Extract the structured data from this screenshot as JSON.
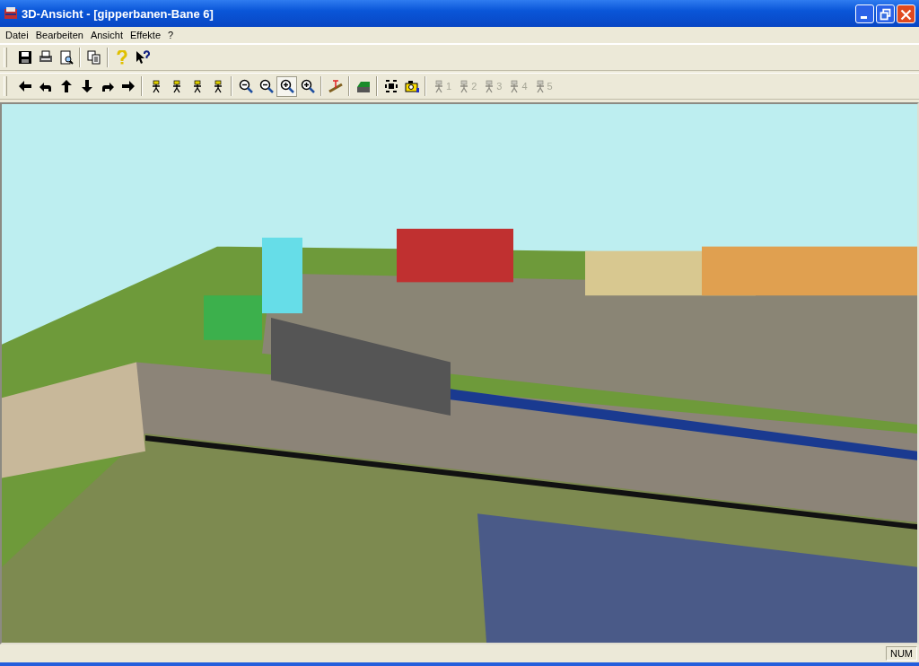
{
  "window": {
    "title": "3D-Ansicht - [gipperbanen-Bane 6]"
  },
  "menu": [
    {
      "label": "Datei"
    },
    {
      "label": "Bearbeiten"
    },
    {
      "label": "Ansicht"
    },
    {
      "label": "Effekte"
    },
    {
      "label": "?"
    }
  ],
  "toolbar_1": [
    [
      {
        "kind": "save",
        "selected": false
      },
      {
        "kind": "print",
        "selected": false
      },
      {
        "kind": "preview",
        "selected": false
      }
    ],
    [
      {
        "kind": "copy",
        "selected": false
      }
    ],
    [
      {
        "kind": "help",
        "selected": false
      },
      {
        "kind": "context-help",
        "selected": false
      }
    ]
  ],
  "toolbar_2": [
    [
      {
        "kind": "left",
        "selected": false
      },
      {
        "kind": "turn-left",
        "selected": false
      },
      {
        "kind": "up",
        "selected": false
      },
      {
        "kind": "down",
        "selected": false
      },
      {
        "kind": "turn-right",
        "selected": false
      },
      {
        "kind": "right",
        "selected": false
      }
    ],
    [
      {
        "kind": "figure",
        "selected": false
      },
      {
        "kind": "figure",
        "selected": false
      },
      {
        "kind": "figure",
        "selected": false
      },
      {
        "kind": "figure",
        "selected": false
      }
    ],
    [
      {
        "kind": "zoom-out",
        "selected": false
      },
      {
        "kind": "zoom-out",
        "selected": false
      },
      {
        "kind": "zoom-in",
        "selected": true
      },
      {
        "kind": "zoom-in",
        "selected": false
      }
    ],
    [
      {
        "kind": "ruler",
        "selected": false
      }
    ],
    [
      {
        "kind": "terrain",
        "selected": false
      }
    ],
    [
      {
        "kind": "fit",
        "selected": false
      },
      {
        "kind": "camera",
        "selected": false
      }
    ],
    [
      {
        "kind": "viewpoint",
        "label": "1",
        "disabled": true,
        "selected": false
      },
      {
        "kind": "viewpoint",
        "label": "2",
        "disabled": true,
        "selected": false
      },
      {
        "kind": "viewpoint",
        "label": "3",
        "disabled": true,
        "selected": false
      },
      {
        "kind": "viewpoint",
        "label": "4",
        "disabled": true,
        "selected": false
      },
      {
        "kind": "viewpoint",
        "label": "5",
        "disabled": true,
        "selected": false
      }
    ]
  ],
  "view": {
    "kind": "picture"
  },
  "status_bar": {
    "indicator": "NUM"
  }
}
